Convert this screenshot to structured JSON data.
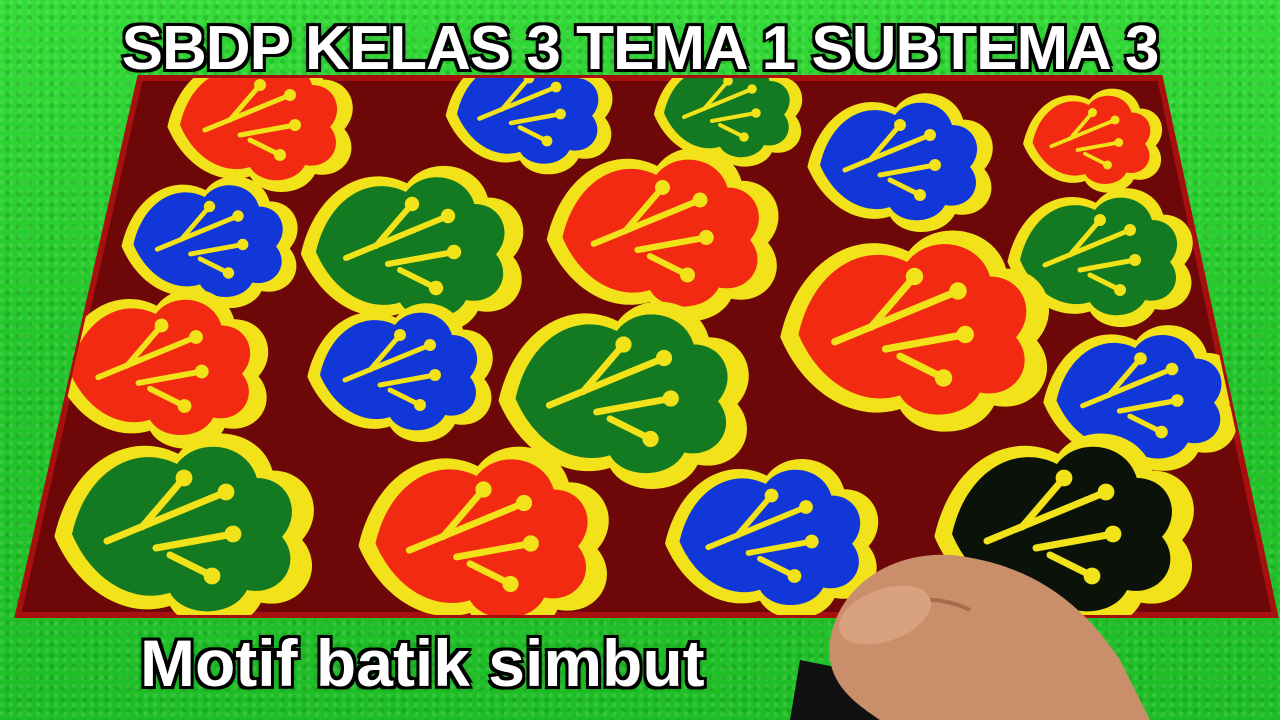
{
  "image": {
    "title": "SBDP KELAS 3 TEMA 1 SUBTEMA 3",
    "caption": "Motif batik simbut"
  },
  "colors": {
    "background": "#2bd130",
    "batik_ground": "#7a0a0a",
    "outline": "#f2e21a",
    "red": "#f22a12",
    "blue": "#1237d8",
    "green": "#137a22",
    "black": "#0a120a"
  }
}
